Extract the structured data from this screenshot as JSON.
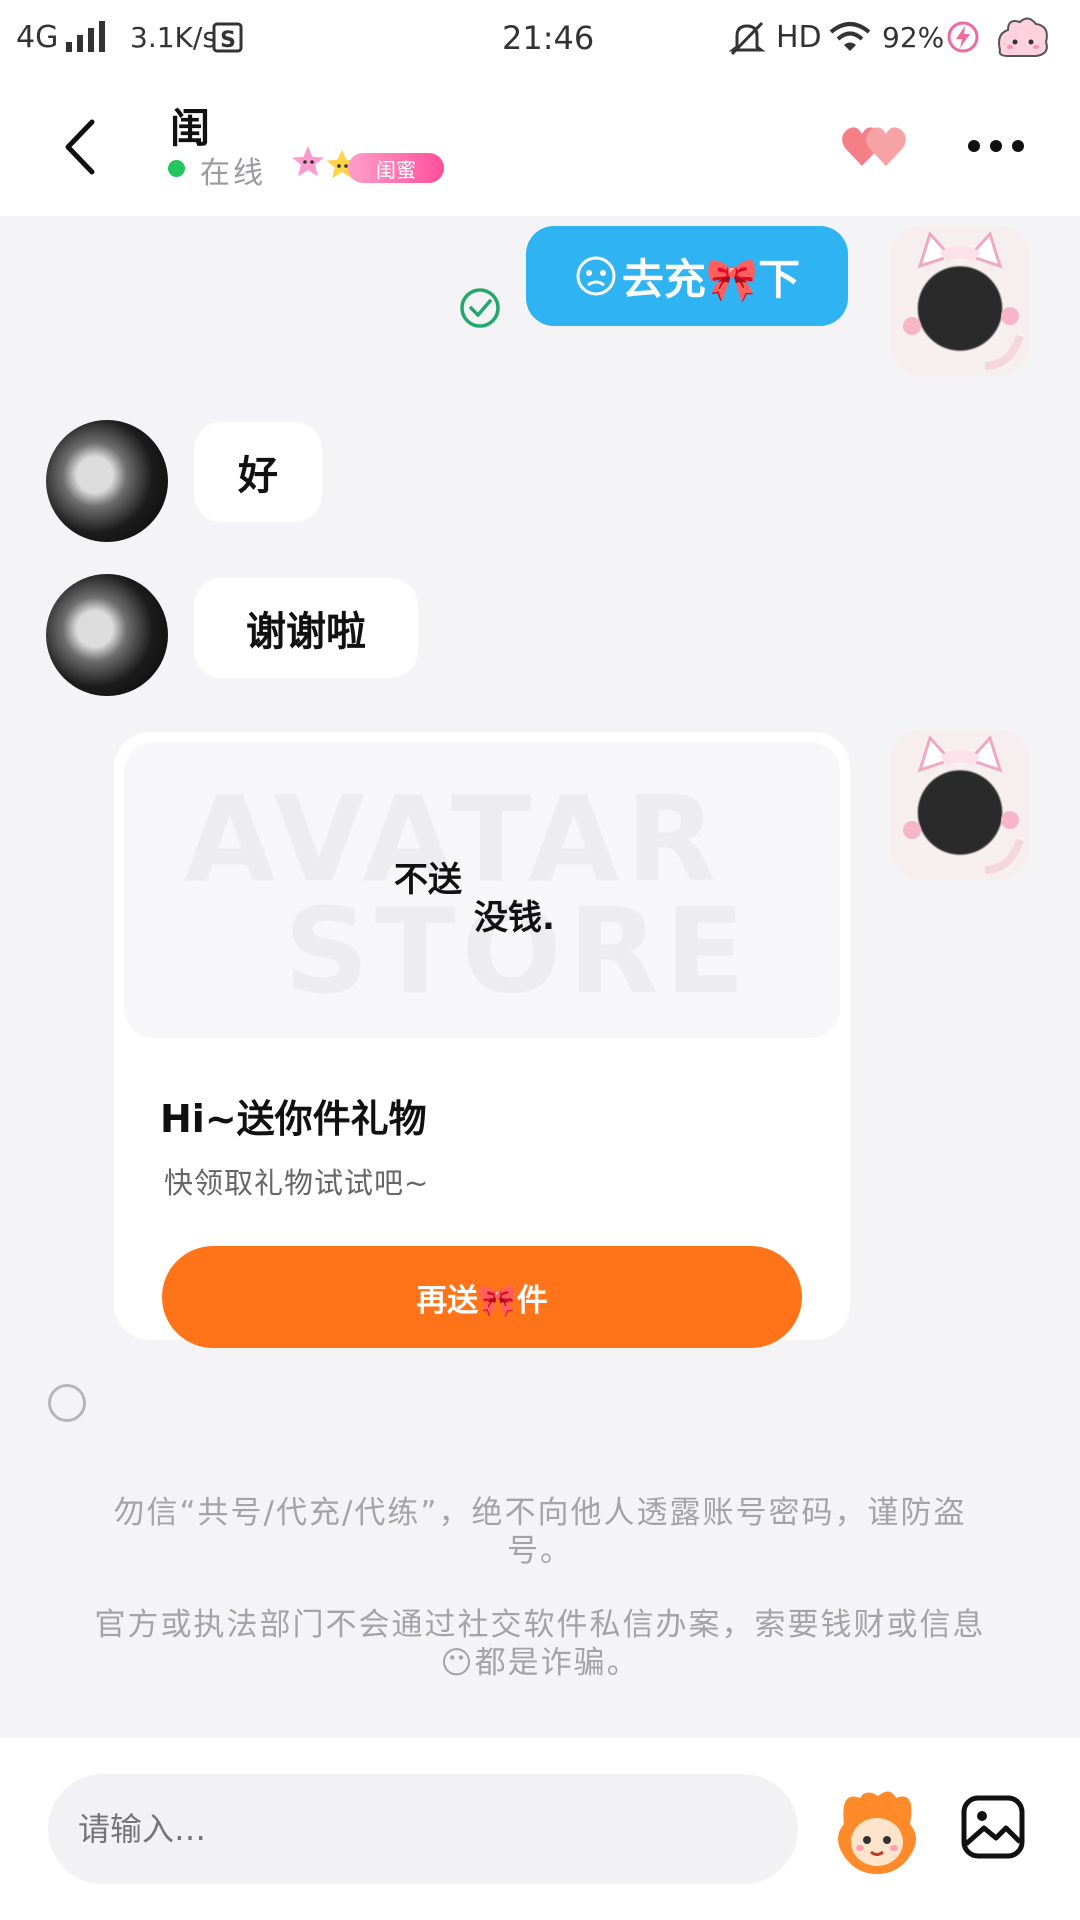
{
  "status_bar": {
    "network": "4G",
    "speed": "3.1K/s",
    "time": "21:46",
    "hd": "HD",
    "battery": "92%"
  },
  "header": {
    "contact_name": "闺",
    "online_status": "在线",
    "relation_badge": "闺蜜"
  },
  "messages": {
    "sent_1": "去充🎀下",
    "received_1": "好",
    "received_2": "谢谢啦"
  },
  "gift_card": {
    "sticker_line1": "不送",
    "sticker_line2": "没钱.",
    "watermark_line1": "AVATAR",
    "watermark_line2": "STORE",
    "title": "Hi~送你件礼物",
    "subtitle": "快领取礼物试试吧~",
    "button_label": "再送🎀件"
  },
  "notices": {
    "line1": "勿信“共号/代充/代练”，绝不向他人透露账号密码，谨防盗号。",
    "line2": "官方或执法部门不会通过社交软件私信办案，索要钱财或信息😶都是诈骗。"
  },
  "input": {
    "placeholder": "请输入…"
  },
  "colors": {
    "sent_bubble": "#2fb3f3",
    "gift_button": "#ff7418",
    "online_dot": "#22c55e",
    "badge_pink": "#ff5fa2",
    "heart": "#f47f86"
  }
}
